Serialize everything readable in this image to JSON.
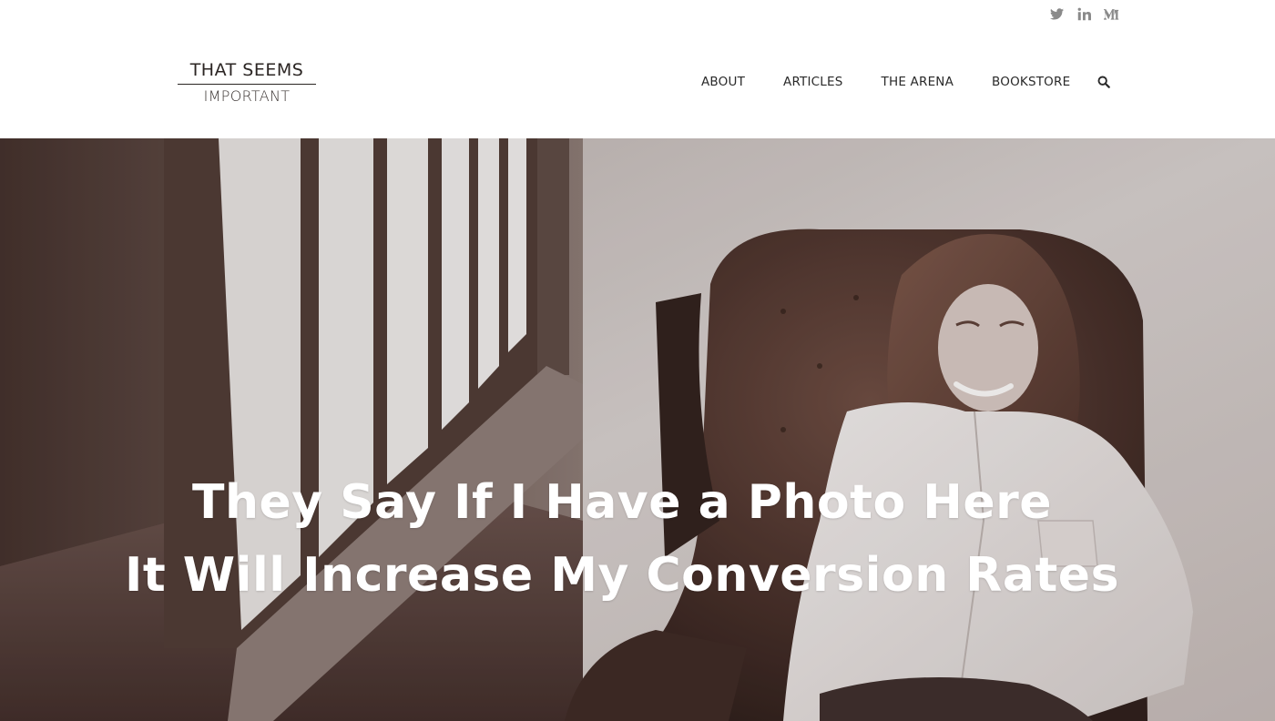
{
  "site": {
    "logo_line1": "THAT SEEMS",
    "logo_line2": "IMPORTANT"
  },
  "social": [
    {
      "icon": "twitter-icon"
    },
    {
      "icon": "linkedin-icon"
    },
    {
      "icon": "medium-icon"
    }
  ],
  "nav": {
    "items": [
      "ABOUT",
      "ARTICLES",
      "THE ARENA",
      "BOOKSTORE"
    ],
    "search_icon": "search-icon"
  },
  "hero": {
    "headline_line1": "They Say If I Have a Photo Here",
    "headline_line2": "It Will Increase My Conversion Rates",
    "tint_color": "#4a3632",
    "text_color": "#ffffff"
  },
  "colors": {
    "nav_text": "#2a2a2a",
    "icon_gray": "#8a8a8a",
    "logo_text": "#2b2523"
  }
}
